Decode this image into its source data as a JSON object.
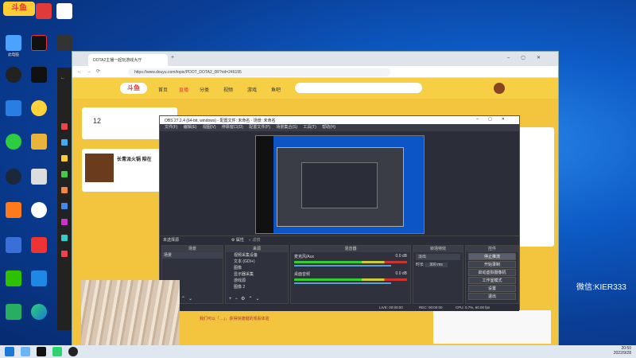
{
  "desktop": {
    "icons": [
      "斗鱼直播",
      "",
      "",
      "此电脑",
      "",
      "",
      "",
      "",
      "",
      "",
      "",
      "",
      "",
      "",
      "",
      "",
      "",
      "",
      "",
      "",
      "",
      "",
      "",
      "",
      "",
      ""
    ]
  },
  "browser": {
    "tab_title": "DOTA2主播一起玩游戏大厅",
    "url": "https://www.douyu.com/topic/PDOT_DOTA2_0R?rid=246195",
    "site_logo": "斗鱼",
    "nav": [
      "首页",
      "直播",
      "分类",
      "视频",
      "游戏",
      "鱼吧"
    ],
    "channel_title": "长青派火锅 陪在",
    "count": "12",
    "bottom_text": "我们可以「…」，获得快捷键的观看体验"
  },
  "obs": {
    "title": "OBS 27.2.4 (64-bit, windows) - 配置文件: 未命名 - 场景: 未命名",
    "menu": [
      "文件(F)",
      "编辑(E)",
      "视图(V)",
      "停靠窗口(D)",
      "配置文件(P)",
      "场景集合(S)",
      "工具(T)",
      "帮助(H)"
    ],
    "no_source": "未选择源",
    "properties_btn": "属性",
    "filters_btn": "滤镜",
    "scenes_header": "场景",
    "scene_item": "场景",
    "sources_header": "来源",
    "sources": [
      "视频采集设备",
      "文本 (GDI+)",
      "图像",
      "显示器采集",
      "游戏源",
      "图像 2"
    ],
    "mixer_header": "混音器",
    "mixer": [
      {
        "name": "麦克风/Aux",
        "db": "0.0 dB"
      },
      {
        "name": "桌面音频",
        "db": "0.0 dB"
      }
    ],
    "transitions_header": "转场特效",
    "transition_value": "淡出",
    "duration_label": "时长",
    "duration_value": "300 ms",
    "controls_header": "控件",
    "controls": [
      "停止推流",
      "开始录制",
      "启动虚拟摄像机",
      "工作室模式",
      "设置",
      "退出"
    ],
    "status": {
      "live": "LIVE: 00:00:00",
      "rec": "REC: 00:00:00",
      "cpu": "CPU: 0.7%, 60.00 fps"
    }
  },
  "taskbar": {
    "time": "20:50",
    "date": "2022/9/28"
  },
  "watermark": "微信:KIER333"
}
